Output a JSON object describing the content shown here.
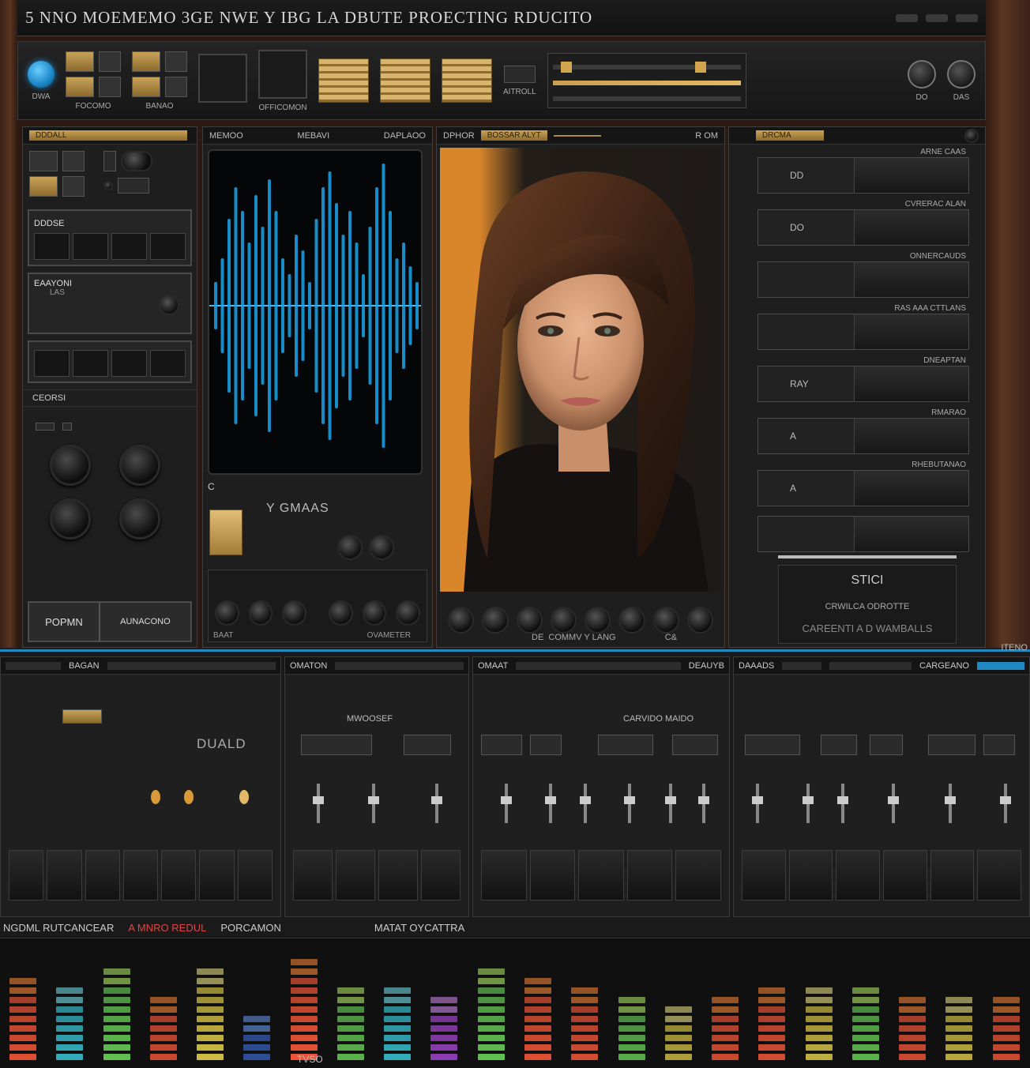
{
  "window": {
    "title": "5 NNO MOEMEMO 3GE NWE Y IBG LA DBUTE PROECTING RDUCITO"
  },
  "toolbar": {
    "items": [
      {
        "label": "DWA"
      },
      {
        "label": "FOCOMO"
      },
      {
        "label": "BANAO"
      },
      {
        "label": "OFFICOMON"
      },
      {
        "label": "AITROLL"
      },
      {
        "label": "DO"
      },
      {
        "label": "DAS"
      }
    ]
  },
  "left_panel": {
    "head": "DDDALL",
    "rack1": "DDDSE",
    "rack2_line1": "EAAYONI",
    "rack2_line2": "LAS",
    "section": "CEORSI",
    "btn_left": "POPMN",
    "btn_right": "AUNACONO"
  },
  "wave_panel": {
    "head_left": "MEMOO",
    "head_center": "MEBAVI",
    "head_right": "DAPLAOO",
    "label_c": "C",
    "label_sub": "Y GMAAS",
    "foot_left": "BAAT",
    "foot_right": "OVAMETER",
    "wave_color": "#1ba4e8"
  },
  "photo_panel": {
    "head_left": "DPHOR",
    "head_tab": "BOSSAR ALYT",
    "head_right": "R OM",
    "foot_text": "DE  COMMV Y LANG",
    "foot_right": "C&"
  },
  "right_panel": {
    "head": "DRCMA",
    "strips": [
      {
        "cap": "ARNE CAAS",
        "label": "DD"
      },
      {
        "cap": "CVRERAC ALAN",
        "label": "DO"
      },
      {
        "cap": "ONNERCAUDS",
        "label": ""
      },
      {
        "cap": "RAS AAA CTTLANS",
        "label": ""
      },
      {
        "cap": "DNEAPTAN",
        "label": "RAY"
      },
      {
        "cap": "RMARAO",
        "label": "A"
      },
      {
        "cap": "RHEBUTANAO",
        "label": "A"
      },
      {
        "cap": "",
        "label": ""
      }
    ],
    "box_title": "STICI",
    "box_line1": "CRWILCA  ODROTTE",
    "box_line2": "CAREENTI A D WAMBALLS"
  },
  "mixer": {
    "sections": [
      {
        "head": "BAGAN",
        "title": "DUALD"
      },
      {
        "head": "OMATON",
        "title": "MWOOSEF"
      },
      {
        "head": "OMAAT",
        "head_right": "DEAUYB",
        "title": "CARVIDO MAIDO"
      },
      {
        "head": "DAAADS",
        "head_right": "CARGEANO",
        "corner": "ITENO"
      }
    ]
  },
  "meters": {
    "labels": [
      "NGDML RUTCANCEAR",
      "A MNRO REDUL",
      "PORCAMON",
      "MATAT OYCATTRA"
    ],
    "foot": "TVSO",
    "columns": [
      {
        "level": 0.75,
        "hue": "red"
      },
      {
        "level": 0.7,
        "hue": "cyan"
      },
      {
        "level": 0.8,
        "hue": "green"
      },
      {
        "level": 0.6,
        "hue": "red"
      },
      {
        "level": 0.85,
        "hue": "yellow"
      },
      {
        "level": 0.4,
        "hue": "blue"
      },
      {
        "level": 0.9,
        "hue": "red"
      },
      {
        "level": 0.7,
        "hue": "green"
      },
      {
        "level": 0.65,
        "hue": "cyan"
      },
      {
        "level": 0.55,
        "hue": "purple"
      },
      {
        "level": 0.8,
        "hue": "green"
      },
      {
        "level": 0.75,
        "hue": "red"
      },
      {
        "level": 0.7,
        "hue": "red"
      },
      {
        "level": 0.6,
        "hue": "green"
      },
      {
        "level": 0.5,
        "hue": "yellow"
      },
      {
        "level": 0.55,
        "hue": "red"
      },
      {
        "level": 0.7,
        "hue": "red"
      },
      {
        "level": 0.65,
        "hue": "yellow"
      },
      {
        "level": 0.7,
        "hue": "green"
      },
      {
        "level": 0.6,
        "hue": "red"
      },
      {
        "level": 0.6,
        "hue": "yellow"
      },
      {
        "level": 0.55,
        "hue": "red"
      }
    ]
  }
}
